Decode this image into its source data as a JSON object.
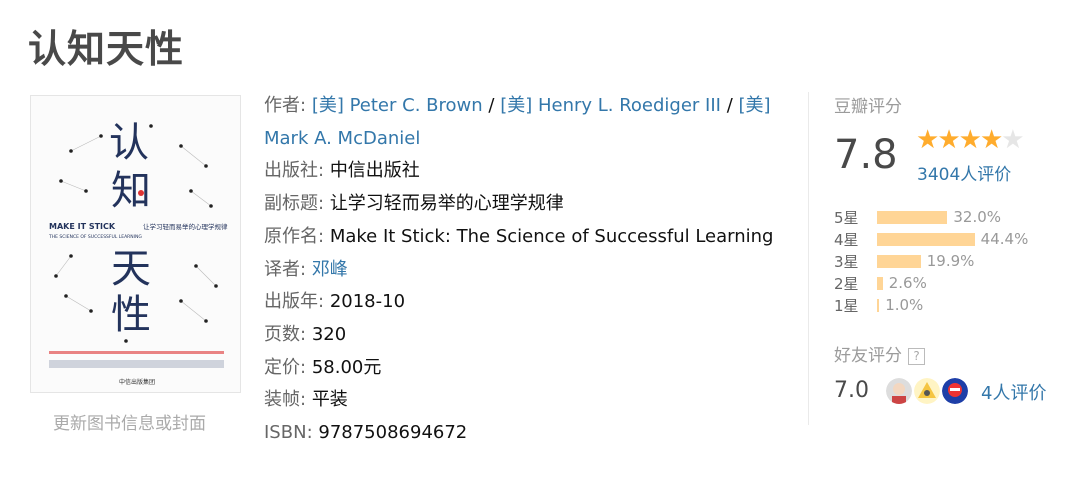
{
  "title": "认知天性",
  "cover": {
    "title_chars": [
      "认",
      "知",
      "天",
      "性"
    ],
    "english": "MAKE IT STICK",
    "english_sub": "THE SCIENCE OF SUCCESSFUL LEARNING",
    "subtitle": "让学习轻而易举的心理学规律",
    "publisher": "中信出版集团"
  },
  "update_link": "更新图书信息或封面",
  "info": {
    "author_label": "作者",
    "authors": [
      "[美] Peter C. Brown",
      "[美] Henry L. Roediger III",
      "[美] Mark A. McDaniel"
    ],
    "publisher_label": "出版社",
    "publisher": "中信出版社",
    "subtitle_label": "副标题",
    "subtitle": "让学习轻而易举的心理学规律",
    "original_title_label": "原作名",
    "original_title": "Make It Stick: The Science of Successful Learning",
    "translator_label": "译者",
    "translator": "邓峰",
    "pub_year_label": "出版年",
    "pub_year": "2018-10",
    "pages_label": "页数",
    "pages": "320",
    "price_label": "定价",
    "price": "58.00元",
    "binding_label": "装帧",
    "binding": "平装",
    "isbn_label": "ISBN",
    "isbn": "9787508694672"
  },
  "rating": {
    "title": "豆瓣评分",
    "score": "7.8",
    "stars_filled": 4,
    "stars_total": 5,
    "count_text": "3404人评价",
    "distribution": [
      {
        "label": "5星",
        "percent": 32.0,
        "text": "32.0%"
      },
      {
        "label": "4星",
        "percent": 44.4,
        "text": "44.4%"
      },
      {
        "label": "3星",
        "percent": 19.9,
        "text": "19.9%"
      },
      {
        "label": "2星",
        "percent": 2.6,
        "text": "2.6%"
      },
      {
        "label": "1星",
        "percent": 1.0,
        "text": "1.0%"
      }
    ],
    "accent_color": "#ffac2d",
    "bar_color": "#ffd596"
  },
  "friends": {
    "title": "好友评分",
    "help_icon": "?",
    "score": "7.0",
    "count_text": "4人评价"
  },
  "colors": {
    "link": "#3377aa",
    "label": "#666666"
  }
}
